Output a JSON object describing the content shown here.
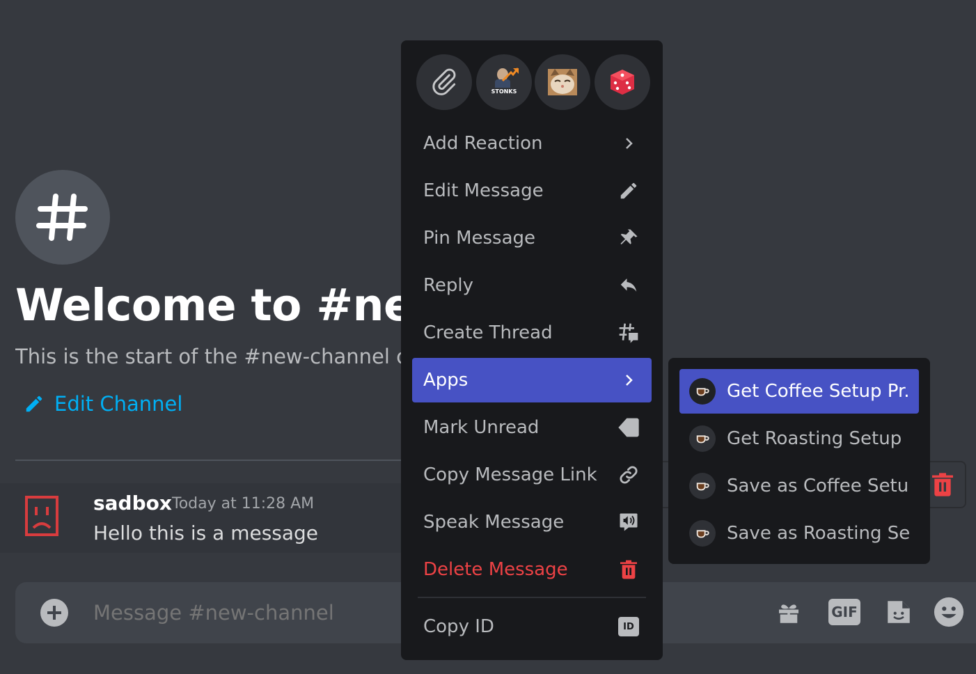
{
  "channel": {
    "welcome_title": "Welcome to #new-channel!",
    "welcome_subtitle": "This is the start of the #new-channel channel.",
    "edit_channel_label": "Edit Channel"
  },
  "message": {
    "author": "sadbox",
    "timestamp": "Today at 11:28 AM",
    "text": "Hello this is a message"
  },
  "composer": {
    "placeholder": "Message #new-channel",
    "gif_label": "GIF"
  },
  "quick_reactions": [
    {
      "name": "paperclip",
      "label": ""
    },
    {
      "name": "stonks",
      "label": "STONKS"
    },
    {
      "name": "cat-face",
      "label": ""
    },
    {
      "name": "dice",
      "label": ""
    }
  ],
  "context_menu": {
    "items": [
      {
        "label": "Add Reaction",
        "icon": "chevron-right-icon"
      },
      {
        "label": "Edit Message",
        "icon": "pencil-icon"
      },
      {
        "label": "Pin Message",
        "icon": "pin-icon"
      },
      {
        "label": "Reply",
        "icon": "reply-icon"
      },
      {
        "label": "Create Thread",
        "icon": "thread-icon"
      },
      {
        "label": "Apps",
        "icon": "chevron-right-icon",
        "active": true
      },
      {
        "label": "Mark Unread",
        "icon": "mark-unread-icon"
      },
      {
        "label": "Copy Message Link",
        "icon": "link-icon"
      },
      {
        "label": "Speak Message",
        "icon": "speak-icon"
      },
      {
        "label": "Delete Message",
        "icon": "trash-icon",
        "danger": true
      },
      {
        "label": "Copy ID",
        "icon": "id-icon"
      }
    ]
  },
  "apps_submenu": {
    "items": [
      {
        "label": "Get Coffee Setup Pr...",
        "active": true
      },
      {
        "label": "Get Roasting Setup ..."
      },
      {
        "label": "Save as Coffee Setu..."
      },
      {
        "label": "Save as Roasting Set..."
      }
    ]
  },
  "colors": {
    "background": "#36393f",
    "menu_bg": "#18191c",
    "accent": "#4752c4",
    "danger": "#ed4245",
    "link": "#00aff4"
  }
}
